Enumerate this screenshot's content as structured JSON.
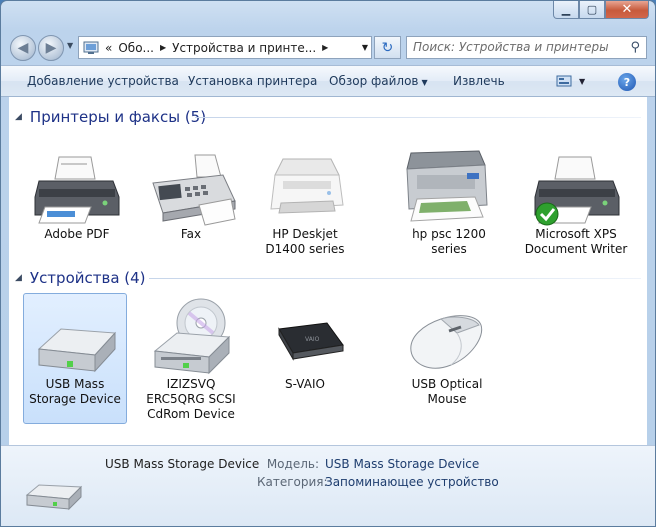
{
  "window": {
    "controls": {
      "minimize": "▁",
      "maximize": "▢",
      "close": "✕"
    }
  },
  "nav": {
    "back_glyph": "◀",
    "forward_glyph": "▶",
    "address": {
      "overflow": "«",
      "crumbs": [
        "Обо...",
        "Устройства и принте..."
      ],
      "dropdown": "▼"
    },
    "refresh_glyph": "↻",
    "search_placeholder": "Поиск: Устройства и принтеры"
  },
  "toolbar": {
    "add_device": "Добавление устройства",
    "add_printer": "Установка принтера",
    "browse_files": "Обзор файлов",
    "eject": "Извлечь",
    "help": "?"
  },
  "groups": {
    "printers": {
      "title": "Принтеры и факсы (5)",
      "items": [
        {
          "label": "Adobe PDF",
          "icon": "printer-icon"
        },
        {
          "label": "Fax",
          "icon": "fax-icon"
        },
        {
          "label": "HP Deskjet D1400 series",
          "icon": "inkjet-printer-icon"
        },
        {
          "label": "hp psc 1200 series",
          "icon": "all-in-one-printer-icon"
        },
        {
          "label": "Microsoft XPS Document Writer",
          "icon": "printer-default-icon",
          "default": true
        }
      ]
    },
    "devices": {
      "title": "Устройства (4)",
      "items": [
        {
          "label": "USB Mass Storage Device",
          "icon": "usb-drive-icon",
          "selected": true
        },
        {
          "label": "IZIZSVQ ERC5QRG SCSI CdRom Device",
          "icon": "cdrom-icon"
        },
        {
          "label": "S-VAIO",
          "icon": "laptop-icon"
        },
        {
          "label": "USB Optical Mouse",
          "icon": "mouse-icon"
        }
      ]
    }
  },
  "details": {
    "title": "USB Mass Storage Device",
    "model_label": "Модель:",
    "model_value": "USB Mass Storage Device",
    "category_label": "Категория:",
    "category_value": "Запоминающее устройство"
  },
  "colors": {
    "group_title": "#1e3287",
    "selection": "#c9e0fb",
    "default_check": "#2ea02e"
  }
}
